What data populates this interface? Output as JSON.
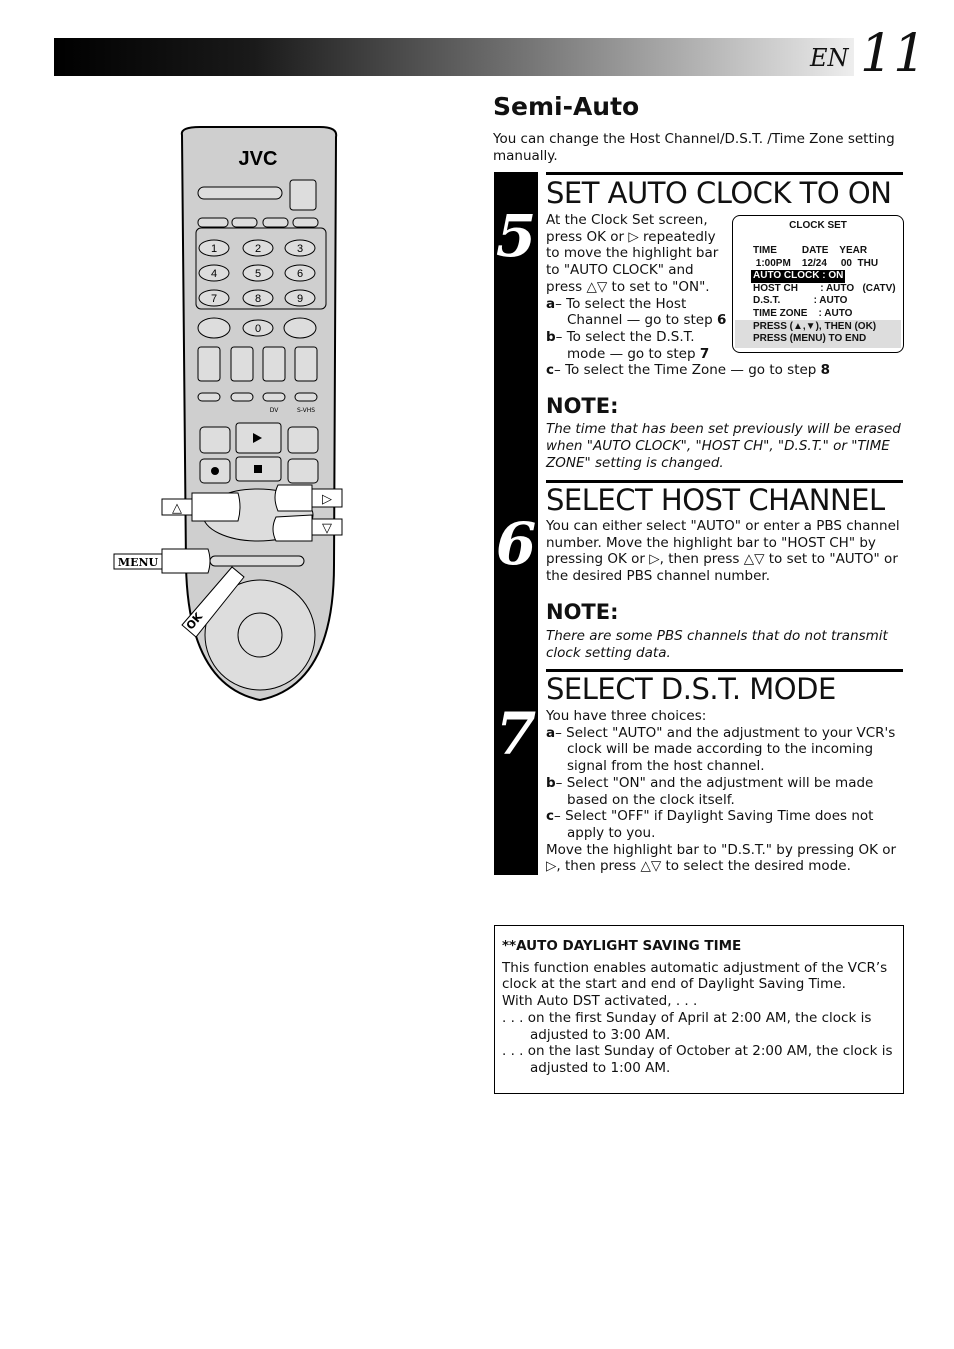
{
  "header": {
    "lang": "EN",
    "page_number": "11"
  },
  "section_title": "Semi-Auto",
  "intro": "You can change the Host Channel/D.S.T. /Time Zone setting manually.",
  "steps": [
    {
      "number": "5",
      "title": "SET AUTO CLOCK TO ON",
      "lines": [
        "At the Clock Set screen,",
        "press OK or ▷ repeatedly",
        "to move the highlight bar",
        "to \"AUTO CLOCK\" and",
        "press △▽ to set to \"ON\"."
      ],
      "options": [
        {
          "key": "a",
          "text": "To select the Host Channel — go to step",
          "step": "6"
        },
        {
          "key": "b",
          "text": "To select the D.S.T. mode — go to step",
          "step": "7"
        },
        {
          "key": "c",
          "text": "To select the Time Zone — go to step",
          "step": "8"
        }
      ],
      "note_label": "NOTE:",
      "note": "The time that has been set previously will be erased when \"AUTO CLOCK\", \"HOST CH\", \"D.S.T.\" or \"TIME ZONE\" setting is changed."
    },
    {
      "number": "6",
      "title": "SELECT HOST CHANNEL",
      "text": "You can either select \"AUTO\" or enter a PBS channel number. Move the highlight bar to \"HOST CH\" by pressing OK or ▷, then press △▽ to set to \"AUTO\" or the desired PBS channel number.",
      "note_label": "NOTE:",
      "note": "There are some PBS channels that do not transmit clock setting data."
    },
    {
      "number": "7",
      "title": "SELECT D.S.T. MODE",
      "intro": "You have three choices:",
      "options": [
        {
          "key": "a",
          "text": "Select \"AUTO\" and the adjustment to your VCR's clock will be made according to the incoming signal from the host channel."
        },
        {
          "key": "b",
          "text": "Select \"ON\" and the adjustment will be made based on the clock itself."
        },
        {
          "key": "c",
          "text": "Select \"OFF\" if Daylight Saving Time does not apply to you."
        }
      ],
      "outro": "Move the highlight bar to \"D.S.T.\" by pressing OK or ▷, then press △▽ to select the desired mode."
    }
  ],
  "clock_screen": {
    "title": "CLOCK SET",
    "header": "TIME         DATE    YEAR",
    "values": " 1:00PM    12/24     00  THU",
    "auto_clock": "AUTO CLOCK : ON",
    "host_ch": "HOST CH        : AUTO   (CATV)",
    "dst": "D.S.T.            : AUTO",
    "time_zone": "TIME ZONE    : AUTO",
    "help1": "PRESS (▲,▼), THEN (OK)",
    "help2": "PRESS (MENU) TO END"
  },
  "remote": {
    "brand": "JVC",
    "keys": [
      "1",
      "2",
      "3",
      "4",
      "5",
      "6",
      "7",
      "8",
      "9",
      "0"
    ],
    "labels": {
      "dv": "DV",
      "svhs": "S-VHS",
      "menu": "MENU",
      "ok": "OK",
      "up": "△",
      "right": "▷",
      "down": "▽"
    }
  },
  "info_box": {
    "title": "**AUTO DAYLIGHT SAVING TIME",
    "text": "This function enables automatic adjustment of the VCR’s clock at the start and end of Daylight Saving Time.",
    "with": "With Auto DST activated, . . .",
    "items": [
      ". . . on the first Sunday of April at 2:00 AM, the clock is adjusted to 3:00 AM.",
      ". . . on the last Sunday of October at 2:00 AM, the clock is adjusted to 1:00 AM."
    ]
  }
}
